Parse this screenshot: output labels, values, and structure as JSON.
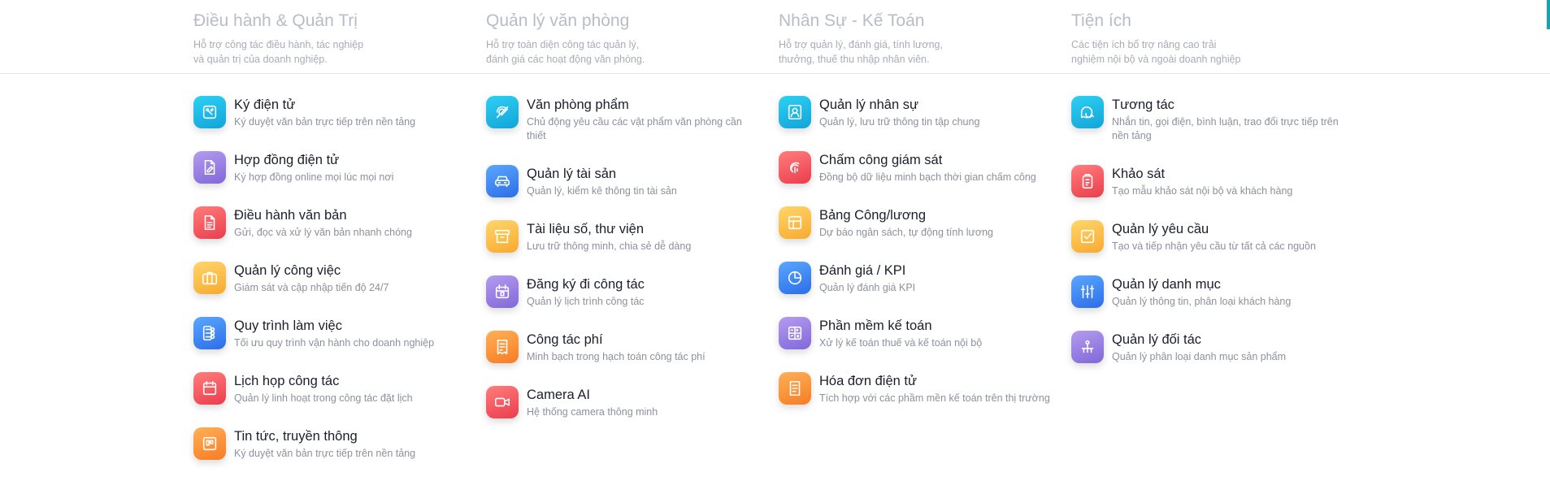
{
  "columns": [
    {
      "title": "Điều hành & Quản Trị",
      "subtitle": "Hỗ trợ công tác điều hành, tác nghiệp\nvà quản trị của doanh nghiệp.",
      "items": [
        {
          "title": "Ký điện tử",
          "desc": "Ký duyệt văn bản trực tiếp trên nền tảng",
          "icon": "sign-icon",
          "color": "#1bb6e6"
        },
        {
          "title": "Hợp đồng điện tử",
          "desc": "Ký hợp đồng online mọi lúc mọi nơi",
          "icon": "contract-icon",
          "color": "#9a82e4"
        },
        {
          "title": "Điều hành văn bản",
          "desc": "Gửi, đọc và xử lý văn bản nhanh chóng",
          "icon": "document-icon",
          "color": "#f2555f"
        },
        {
          "title": "Quản lý công việc",
          "desc": "Giám sát và cập nhập tiến độ 24/7",
          "icon": "briefcase-icon",
          "color": "#fbbf4a"
        },
        {
          "title": "Quy trình làm việc",
          "desc": "Tối ưu quy trình vận hành cho doanh nghiệp",
          "icon": "workflow-icon",
          "color": "#3b86f2"
        },
        {
          "title": "Lịch họp công tác",
          "desc": "Quản lý linh hoạt trong công tác đặt lịch",
          "icon": "calendar-icon",
          "color": "#f2555f"
        },
        {
          "title": "Tin tức, truyền thông",
          "desc": "Ký duyệt văn bản trực tiếp trên nền tảng",
          "icon": "news-icon",
          "color": "#fb963d"
        }
      ]
    },
    {
      "title": "Quản lý văn phòng",
      "subtitle": "Hỗ trợ toàn diện công tác quản lý,\nđánh giá các hoạt động văn phòng.",
      "items": [
        {
          "title": "Văn phòng phẩm",
          "desc": "Chủ động yêu cầu các vật phẩm văn phòng cần thiết",
          "icon": "stationery-icon",
          "color": "#1bb6e6"
        },
        {
          "title": "Quản lý tài sản",
          "desc": "Quản lý, kiểm kê thông tin tài sản",
          "icon": "car-icon",
          "color": "#3b86f2"
        },
        {
          "title": "Tài liệu số, thư viện",
          "desc": "Lưu trữ thông minh, chia sẻ dễ dàng",
          "icon": "archive-icon",
          "color": "#fbbf4a"
        },
        {
          "title": "Đăng ký đi công tác",
          "desc": "Quản lý lịch trình công tác",
          "icon": "travel-icon",
          "color": "#9a82e4"
        },
        {
          "title": "Công tác phí",
          "desc": "Minh bạch trong hạch toán công tác phí",
          "icon": "receipt-icon",
          "color": "#fb963d"
        },
        {
          "title": "Camera AI",
          "desc": "Hệ thống camera thông minh",
          "icon": "camera-icon",
          "color": "#f2555f"
        }
      ]
    },
    {
      "title": "Nhân Sự - Kế Toán",
      "subtitle": "Hỗ trợ quản lý, đánh giá, tính lương,\nthưởng, thuế thu nhập nhân viên.",
      "items": [
        {
          "title": "Quản lý nhân sự",
          "desc": "Quản lý, lưu trữ thông tin tập chung",
          "icon": "person-icon",
          "color": "#1bb6e6"
        },
        {
          "title": "Chấm công giám sát",
          "desc": "Đồng bộ dữ liệu minh bạch thời gian chấm công",
          "icon": "fingerprint-icon",
          "color": "#f2555f"
        },
        {
          "title": "Bảng Công/lương",
          "desc": "Dự báo ngân sách, tự động tính lương",
          "icon": "layout-icon",
          "color": "#fbbf4a"
        },
        {
          "title": "Đánh giá / KPI",
          "desc": "Quản lý đánh giá KPI",
          "icon": "pie-chart-icon",
          "color": "#3b86f2"
        },
        {
          "title": "Phần mềm kế toán",
          "desc": "Xử lý kế toán thuế và kế toán nội bộ",
          "icon": "calculator-icon",
          "color": "#9a82e4"
        },
        {
          "title": "Hóa đơn điện tử",
          "desc": "Tích hợp với các phầm mền kế toán trên thị trường",
          "icon": "invoice-icon",
          "color": "#fb963d"
        }
      ]
    },
    {
      "title": "Tiện ích",
      "subtitle": "Các tiện ích bổ trợ nâng cao trải\nnghiệm nội bộ và ngoài doanh nghiệp",
      "items": [
        {
          "title": "Tương tác",
          "desc": "Nhắn tin, gọi điện, bình luận, trao đổi trực tiếp trên nền tảng",
          "icon": "chat-icon",
          "color": "#1bb6e6"
        },
        {
          "title": "Khảo sát",
          "desc": "Tạo mẫu khảo sát nội bộ và khách hàng",
          "icon": "clipboard-icon",
          "color": "#f2555f"
        },
        {
          "title": "Quản lý yêu cầu",
          "desc": "Tạo và tiếp nhận yêu cầu từ tất cả các nguồn",
          "icon": "checkbox-icon",
          "color": "#fbbf4a"
        },
        {
          "title": "Quản lý danh mục",
          "desc": "Quản lý thông tin, phân loại khách hàng",
          "icon": "sliders-icon",
          "color": "#3b86f2"
        },
        {
          "title": "Quản lý đối tác",
          "desc": "Quản lý phân loại danh mục sản phẩm",
          "icon": "network-icon",
          "color": "#9a82e4"
        }
      ]
    }
  ]
}
